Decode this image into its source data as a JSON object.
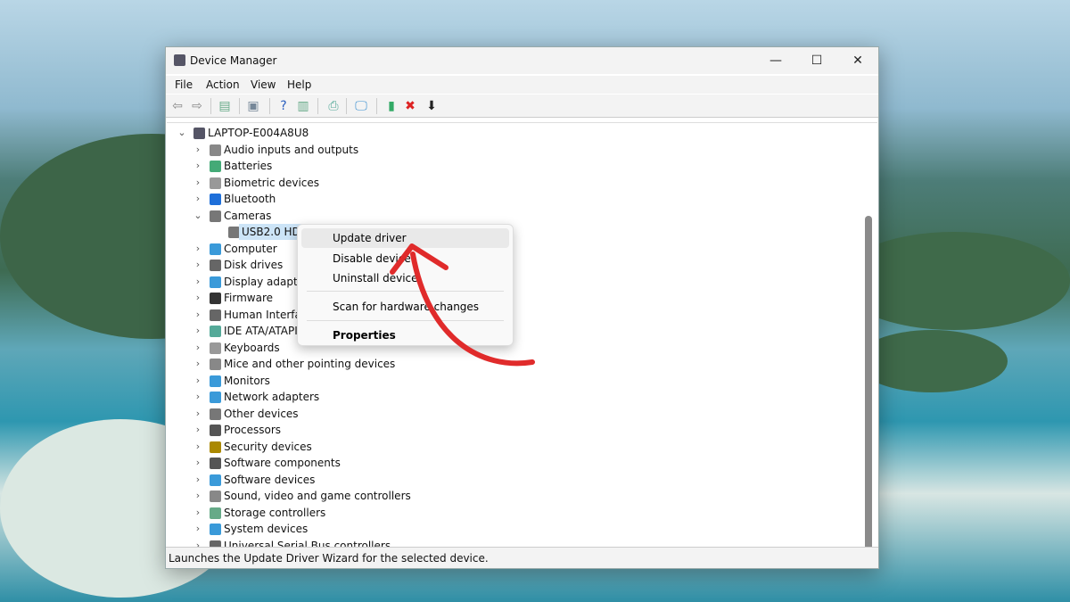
{
  "window": {
    "title": "Device Manager",
    "minimize": "—",
    "maximize": "☐",
    "close": "✕"
  },
  "menu": [
    "File",
    "Action",
    "View",
    "Help"
  ],
  "toolbar": [
    {
      "icon": "back-arrow-icon",
      "glyph": "⇦",
      "color": "#888"
    },
    {
      "icon": "forward-arrow-icon",
      "glyph": "⇨",
      "color": "#888"
    },
    {
      "icon": "show-hide-console-tree-icon",
      "glyph": "▤",
      "color": "#6a8"
    },
    {
      "icon": "properties-icon",
      "glyph": "▣",
      "color": "#789"
    },
    {
      "icon": "help-icon",
      "glyph": "?",
      "color": "#2a5fbf"
    },
    {
      "icon": "action-pane-icon",
      "glyph": "▥",
      "color": "#6a8"
    },
    {
      "icon": "update-driver-icon",
      "glyph": "⎙",
      "color": "#5a9"
    },
    {
      "icon": "scan-hardware-icon",
      "glyph": "🖵",
      "color": "#3a8fd0"
    },
    {
      "icon": "add-legacy-hardware-icon",
      "glyph": "▮",
      "color": "#3a6"
    },
    {
      "icon": "uninstall-icon",
      "glyph": "✖",
      "color": "#d22"
    },
    {
      "icon": "disable-device-icon",
      "glyph": "⬇",
      "color": "#222"
    }
  ],
  "tree": {
    "root": "LAPTOP-E004A8U8",
    "items": [
      {
        "label": "Audio inputs and outputs",
        "expanded": false,
        "color": "#888"
      },
      {
        "label": "Batteries",
        "expanded": false,
        "color": "#4a7"
      },
      {
        "label": "Biometric devices",
        "expanded": false,
        "color": "#999"
      },
      {
        "label": "Bluetooth",
        "expanded": false,
        "color": "#1e6fd9"
      },
      {
        "label": "Cameras",
        "expanded": true,
        "color": "#777",
        "children": [
          "USB2.0 HD U"
        ]
      },
      {
        "label": "Computer",
        "expanded": false,
        "color": "#3a9ad9"
      },
      {
        "label": "Disk drives",
        "expanded": false,
        "color": "#666"
      },
      {
        "label": "Display adapter",
        "expanded": false,
        "color": "#3a9ad9"
      },
      {
        "label": "Firmware",
        "expanded": false,
        "color": "#333"
      },
      {
        "label": "Human Interfac",
        "expanded": false,
        "color": "#666"
      },
      {
        "label": "IDE ATA/ATAPI cc",
        "expanded": false,
        "color": "#5a9"
      },
      {
        "label": "Keyboards",
        "expanded": false,
        "color": "#999"
      },
      {
        "label": "Mice and other pointing devices",
        "expanded": false,
        "color": "#888"
      },
      {
        "label": "Monitors",
        "expanded": false,
        "color": "#3a9ad9"
      },
      {
        "label": "Network adapters",
        "expanded": false,
        "color": "#3a9ad9"
      },
      {
        "label": "Other devices",
        "expanded": false,
        "color": "#777"
      },
      {
        "label": "Processors",
        "expanded": false,
        "color": "#555"
      },
      {
        "label": "Security devices",
        "expanded": false,
        "color": "#a80"
      },
      {
        "label": "Software components",
        "expanded": false,
        "color": "#555"
      },
      {
        "label": "Software devices",
        "expanded": false,
        "color": "#3a9ad9"
      },
      {
        "label": "Sound, video and game controllers",
        "expanded": false,
        "color": "#888"
      },
      {
        "label": "Storage controllers",
        "expanded": false,
        "color": "#6a8"
      },
      {
        "label": "System devices",
        "expanded": false,
        "color": "#3a9ad9"
      },
      {
        "label": "Universal Serial Bus controllers",
        "expanded": false,
        "color": "#666"
      }
    ]
  },
  "context_menu": {
    "items": [
      "Update driver",
      "Disable device",
      "Uninstall device",
      "Scan for hardware changes",
      "Properties"
    ],
    "highlighted": "Update driver"
  },
  "status": "Launches the Update Driver Wizard for the selected device.",
  "annotation_color": "#e02b2b"
}
